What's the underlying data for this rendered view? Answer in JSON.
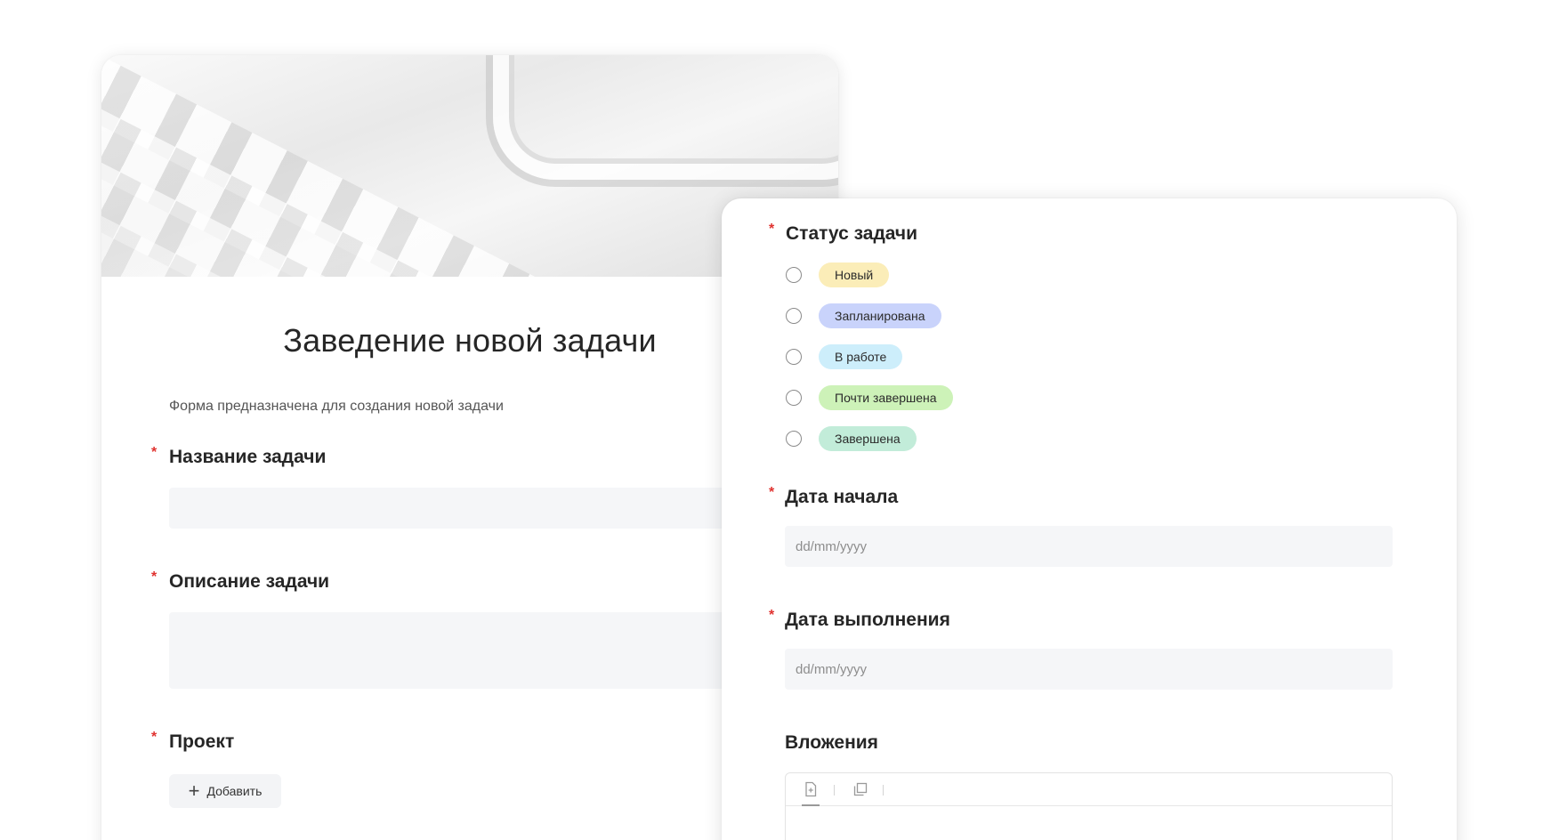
{
  "left_form": {
    "title": "Заведение новой задачи",
    "description": "Форма предназначена для создания новой задачи",
    "required_mark": "*",
    "fields": {
      "name_label": "Название задачи",
      "description_label": "Описание задачи",
      "project_label": "Проект",
      "add_button_label": "Добавить"
    }
  },
  "right_form": {
    "required_mark": "*",
    "status": {
      "label": "Статус задачи",
      "options": [
        {
          "label": "Новый",
          "color": "#fbedb8"
        },
        {
          "label": "Запланирована",
          "color": "#c9d3fb"
        },
        {
          "label": "В работе",
          "color": "#cdeefb"
        },
        {
          "label": "Почти завершена",
          "color": "#cdf2b8"
        },
        {
          "label": "Завершена",
          "color": "#c2ecd9"
        }
      ]
    },
    "start_date": {
      "label": "Дата начала",
      "placeholder": "dd/mm/yyyy"
    },
    "due_date": {
      "label": "Дата выполнения",
      "placeholder": "dd/mm/yyyy"
    },
    "attachments": {
      "label": "Вложения",
      "tab_icons": [
        "add-file-icon",
        "copy-icon"
      ]
    }
  }
}
